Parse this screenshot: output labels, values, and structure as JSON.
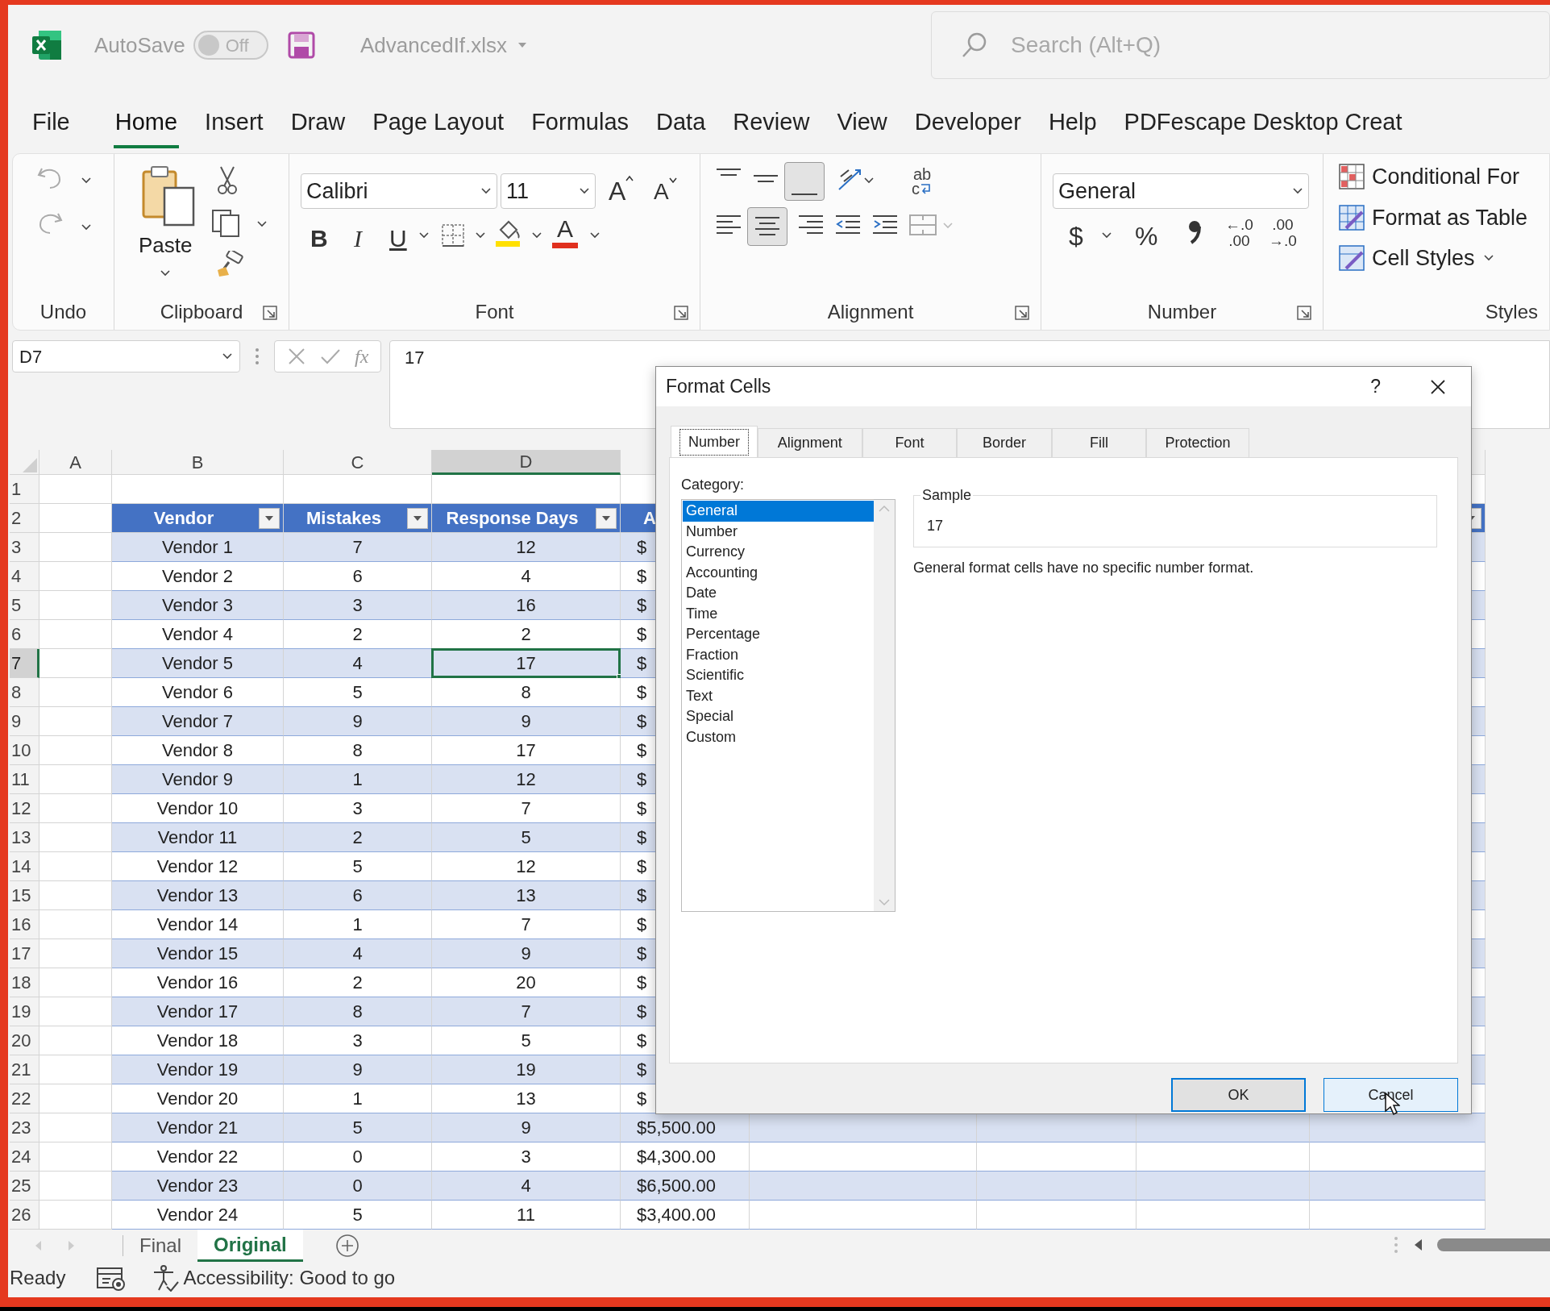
{
  "title_bar": {
    "autosave_label": "AutoSave",
    "autosave": {
      "on": false,
      "label": "Off"
    },
    "file_name": "AdvancedIf.xlsx",
    "search_placeholder": "Search (Alt+Q)"
  },
  "menu_tabs": [
    {
      "label": "File",
      "selected": false
    },
    {
      "label": "Home",
      "selected": true
    },
    {
      "label": "Insert",
      "selected": false
    },
    {
      "label": "Draw",
      "selected": false
    },
    {
      "label": "Page Layout",
      "selected": false
    },
    {
      "label": "Formulas",
      "selected": false
    },
    {
      "label": "Data",
      "selected": false
    },
    {
      "label": "Review",
      "selected": false
    },
    {
      "label": "View",
      "selected": false
    },
    {
      "label": "Developer",
      "selected": false
    },
    {
      "label": "Help",
      "selected": false
    },
    {
      "label": "PDFescape Desktop Creat",
      "selected": false
    }
  ],
  "ribbon": {
    "undo_group": {
      "label": "Undo"
    },
    "clipboard_group": {
      "paste_label": "Paste",
      "label": "Clipboard"
    },
    "font_group": {
      "font_name": "Calibri",
      "font_size": "11",
      "grow_font": "A",
      "shrink_font": "A",
      "bold": "B",
      "italic": "I",
      "underline": "U",
      "font_color": "A",
      "label": "Font"
    },
    "alignment_group": {
      "wrap_text": "ab",
      "wrap_text_2": "c",
      "label": "Alignment"
    },
    "number_group": {
      "format": "General",
      "currency": "$",
      "percent": "%",
      "increase_decimal": [
        "←.0",
        ".00"
      ],
      "decrease_decimal": [
        ".00",
        "→.0"
      ],
      "label": "Number"
    },
    "styles_group": {
      "items": [
        "Conditional For",
        "Format as Table",
        "Cell Styles"
      ],
      "label": "Styles"
    }
  },
  "formula_bar": {
    "name_box": "D7",
    "fx": "fx",
    "value": "17"
  },
  "sheet": {
    "columns": [
      {
        "label": "A",
        "selected": false
      },
      {
        "label": "B",
        "selected": false
      },
      {
        "label": "C",
        "selected": false
      },
      {
        "label": "D",
        "selected": true
      }
    ],
    "rows": [
      {
        "number": "1",
        "selected": false
      },
      {
        "number": "2",
        "selected": false,
        "kind": "header",
        "cells": [
          {
            "label": "Vendor",
            "filter_button": true
          },
          {
            "label": "Mistakes",
            "filter_button": true
          },
          {
            "label": "Response Days",
            "filter_button": true
          },
          {
            "label": "A"
          }
        ],
        "last_column_filter_button": true
      },
      {
        "number": "3",
        "selected": false,
        "kind": "data",
        "banded": true,
        "cells": [
          "Vendor 1",
          "7",
          "12",
          "$"
        ]
      },
      {
        "number": "4",
        "selected": false,
        "kind": "data",
        "banded": false,
        "cells": [
          "Vendor 2",
          "6",
          "4",
          "$"
        ]
      },
      {
        "number": "5",
        "selected": false,
        "kind": "data",
        "banded": true,
        "cells": [
          "Vendor 3",
          "3",
          "16",
          "$"
        ]
      },
      {
        "number": "6",
        "selected": false,
        "kind": "data",
        "banded": false,
        "cells": [
          "Vendor 4",
          "2",
          "2",
          "$"
        ]
      },
      {
        "number": "7",
        "selected": true,
        "kind": "data",
        "banded": true,
        "cells": [
          "Vendor 5",
          "4",
          "17",
          "$"
        ]
      },
      {
        "number": "8",
        "selected": false,
        "kind": "data",
        "banded": false,
        "cells": [
          "Vendor 6",
          "5",
          "8",
          "$"
        ]
      },
      {
        "number": "9",
        "selected": false,
        "kind": "data",
        "banded": true,
        "cells": [
          "Vendor 7",
          "9",
          "9",
          "$"
        ]
      },
      {
        "number": "10",
        "selected": false,
        "kind": "data",
        "banded": false,
        "cells": [
          "Vendor 8",
          "8",
          "17",
          "$"
        ]
      },
      {
        "number": "11",
        "selected": false,
        "kind": "data",
        "banded": true,
        "cells": [
          "Vendor 9",
          "1",
          "12",
          "$"
        ]
      },
      {
        "number": "12",
        "selected": false,
        "kind": "data",
        "banded": false,
        "cells": [
          "Vendor 10",
          "3",
          "7",
          "$"
        ]
      },
      {
        "number": "13",
        "selected": false,
        "kind": "data",
        "banded": true,
        "cells": [
          "Vendor 11",
          "2",
          "5",
          "$"
        ]
      },
      {
        "number": "14",
        "selected": false,
        "kind": "data",
        "banded": false,
        "cells": [
          "Vendor 12",
          "5",
          "12",
          "$"
        ]
      },
      {
        "number": "15",
        "selected": false,
        "kind": "data",
        "banded": true,
        "cells": [
          "Vendor 13",
          "6",
          "13",
          "$"
        ]
      },
      {
        "number": "16",
        "selected": false,
        "kind": "data",
        "banded": false,
        "cells": [
          "Vendor 14",
          "1",
          "7",
          "$"
        ]
      },
      {
        "number": "17",
        "selected": false,
        "kind": "data",
        "banded": true,
        "cells": [
          "Vendor 15",
          "4",
          "9",
          "$"
        ]
      },
      {
        "number": "18",
        "selected": false,
        "kind": "data",
        "banded": false,
        "cells": [
          "Vendor 16",
          "2",
          "20",
          "$"
        ]
      },
      {
        "number": "19",
        "selected": false,
        "kind": "data",
        "banded": true,
        "cells": [
          "Vendor 17",
          "8",
          "7",
          "$"
        ]
      },
      {
        "number": "20",
        "selected": false,
        "kind": "data",
        "banded": false,
        "cells": [
          "Vendor 18",
          "3",
          "5",
          "$"
        ]
      },
      {
        "number": "21",
        "selected": false,
        "kind": "data",
        "banded": true,
        "cells": [
          "Vendor 19",
          "9",
          "19",
          "$"
        ]
      },
      {
        "number": "22",
        "selected": false,
        "kind": "data",
        "banded": false,
        "cells": [
          "Vendor 20",
          "1",
          "13",
          "$"
        ]
      },
      {
        "number": "23",
        "selected": false,
        "kind": "data",
        "banded": true,
        "cells": [
          "Vendor 21",
          "5",
          "9",
          "$5,500.00"
        ]
      },
      {
        "number": "24",
        "selected": false,
        "kind": "data",
        "banded": false,
        "cells": [
          "Vendor 22",
          "0",
          "3",
          "$4,300.00"
        ]
      },
      {
        "number": "25",
        "selected": false,
        "kind": "data",
        "banded": true,
        "cells": [
          "Vendor 23",
          "0",
          "4",
          "$6,500.00"
        ]
      },
      {
        "number": "26",
        "selected": false,
        "kind": "data",
        "banded": false,
        "cells": [
          "Vendor 24",
          "5",
          "11",
          "$3,400.00"
        ]
      }
    ]
  },
  "sheet_tabs": [
    {
      "label": "Final",
      "selected": false
    },
    {
      "label": "Original",
      "selected": true
    }
  ],
  "status_bar": {
    "mode": "Ready",
    "accessibility": "Accessibility: Good to go"
  },
  "dialog": {
    "title": "Format Cells",
    "help": "?",
    "tabs": [
      {
        "label": "Number",
        "selected": true
      },
      {
        "label": "Alignment",
        "selected": false
      },
      {
        "label": "Font",
        "selected": false
      },
      {
        "label": "Border",
        "selected": false
      },
      {
        "label": "Fill",
        "selected": false
      },
      {
        "label": "Protection",
        "selected": false
      }
    ],
    "category_label": "Category:",
    "categories": [
      {
        "label": "General",
        "selected": true
      },
      {
        "label": "Number",
        "selected": false
      },
      {
        "label": "Currency",
        "selected": false
      },
      {
        "label": "Accounting",
        "selected": false
      },
      {
        "label": "Date",
        "selected": false
      },
      {
        "label": "Time",
        "selected": false
      },
      {
        "label": "Percentage",
        "selected": false
      },
      {
        "label": "Fraction",
        "selected": false
      },
      {
        "label": "Scientific",
        "selected": false
      },
      {
        "label": "Text",
        "selected": false
      },
      {
        "label": "Special",
        "selected": false
      },
      {
        "label": "Custom",
        "selected": false
      }
    ],
    "sample_label": "Sample",
    "sample_value": "17",
    "description": "General format cells have no specific number format.",
    "buttons": [
      {
        "label": "OK",
        "kind": "default"
      },
      {
        "label": "Cancel",
        "kind": "hover"
      }
    ]
  }
}
